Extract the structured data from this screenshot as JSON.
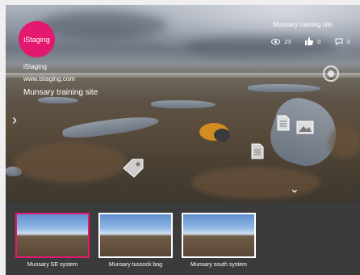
{
  "brand": {
    "logo_text": "iStaging",
    "name": "iStaging",
    "url": "www.istaging.com",
    "site_name": "Munsary training site",
    "accent_color": "#e3186e"
  },
  "header": {
    "title": "Munsary training site"
  },
  "stats": {
    "views": "23",
    "likes": "0",
    "comments": "0",
    "icons": [
      "eye-icon",
      "thumbs-up-icon",
      "comment-icon"
    ]
  },
  "navigation": {
    "left_arrow": "›",
    "down_arrow": "⌄"
  },
  "hotspots": [
    "document-icon",
    "image-icon",
    "document-icon",
    "tag-icon"
  ],
  "scenes": [
    {
      "label": "Munsary SE system",
      "active": true
    },
    {
      "label": "Munsary tussock bog",
      "active": false
    },
    {
      "label": "Munsary south system",
      "active": false
    }
  ]
}
